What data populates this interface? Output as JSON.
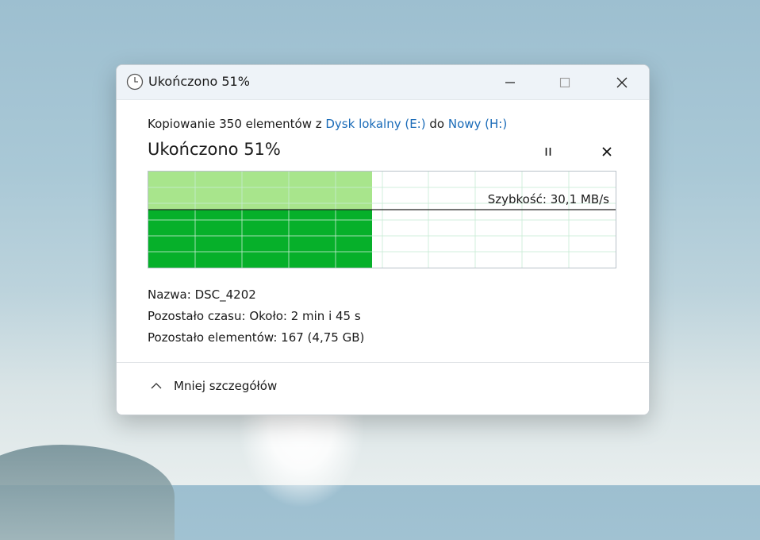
{
  "window": {
    "title": "Ukończono 51%",
    "controls": {
      "minimize": "minimize-icon",
      "maximize": "maximize-icon",
      "close": "close-icon"
    }
  },
  "copy": {
    "prefix": "Kopiowanie 350 elementów z ",
    "source": "Dysk lokalny (E:)",
    "middle": " do ",
    "destination": "Nowy (H:)",
    "progress_heading": "Ukończono 51%",
    "progress_fraction": 0.51,
    "speed_label": "Szybkość: 30,1 MB/s"
  },
  "details": {
    "name_label": "Nazwa:",
    "name_value": "DSC_4202",
    "time_label": "Pozostało czasu:",
    "time_value": "Około: 2 min i 45 s",
    "items_label": "Pozostało elementów:",
    "items_value": "167 (4,75 GB)"
  },
  "footer": {
    "less_details": "Mniej szczegółów"
  },
  "colors": {
    "progress_dark": "#06b02a",
    "progress_light": "#a8e58c",
    "grid": "#c8ecd4",
    "link": "#1a6bb8"
  }
}
